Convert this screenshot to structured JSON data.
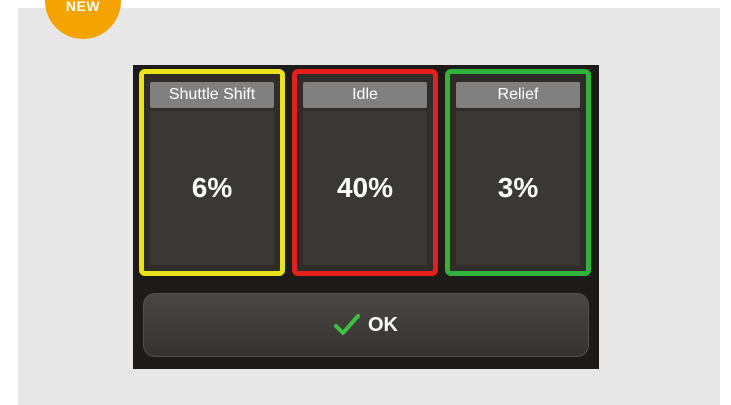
{
  "badge": {
    "label": "NEW",
    "color": "#f4a300"
  },
  "cards": [
    {
      "label": "Shuttle Shift",
      "value": "6%",
      "border_color": "#ece21c"
    },
    {
      "label": "Idle",
      "value": "40%",
      "border_color": "#e5201c"
    },
    {
      "label": "Relief",
      "value": "3%",
      "border_color": "#2eb33d"
    }
  ],
  "ok_button": {
    "label": "OK",
    "icon": "check-icon",
    "icon_color": "#3fbf3f"
  }
}
